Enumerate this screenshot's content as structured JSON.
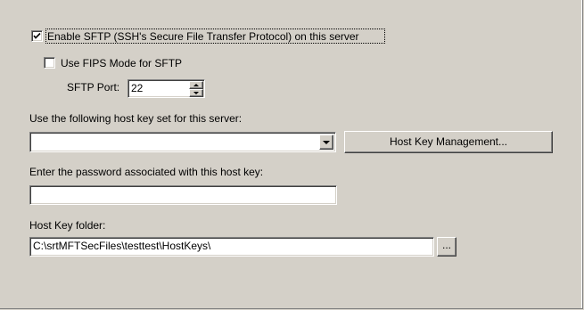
{
  "sftp": {
    "enable_label": "Enable SFTP (SSH's Secure File Transfer Protocol) on this server",
    "enable_checked": true,
    "fips_label": "Use FIPS Mode for SFTP",
    "fips_checked": false,
    "port_label": "SFTP Port:",
    "port_value": "22"
  },
  "host_key": {
    "set_label": "Use the following host key set for this server:",
    "selected_value": "",
    "management_button": "Host Key Management...",
    "password_label": "Enter the password associated with this host key:",
    "password_value": "",
    "folder_label": "Host Key folder:",
    "folder_value": "C:\\srtMFTSecFiles\\testtest\\HostKeys\\",
    "browse_button": "..."
  },
  "icons": {
    "check": "checkmark-icon",
    "dropdown": "chevron-down-icon",
    "spin_up": "spin-up-icon",
    "spin_down": "spin-down-icon"
  }
}
